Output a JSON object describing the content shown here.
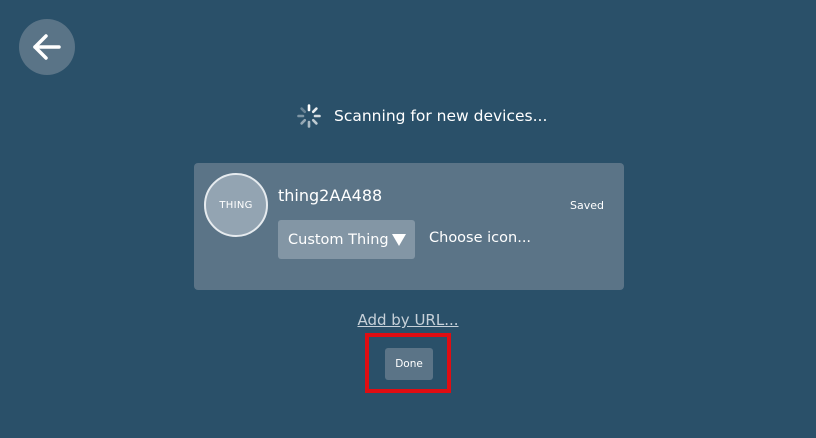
{
  "header": {
    "back_icon": "arrow-left-icon"
  },
  "scan": {
    "spinner_icon": "loading-spinner-icon",
    "status_text": "Scanning for new devices..."
  },
  "device": {
    "icon_label": "THING",
    "name": "thing2AA488",
    "status": "Saved",
    "type_select": {
      "selected": "Custom Thing",
      "arrow_icon": "caret-down-icon"
    },
    "choose_icon_label": "Choose icon..."
  },
  "footer": {
    "add_by_url_label": "Add by URL...",
    "done_label": "Done"
  },
  "colors": {
    "background": "#2a5069",
    "card": "#5b7487",
    "highlight": "#e00d12"
  }
}
